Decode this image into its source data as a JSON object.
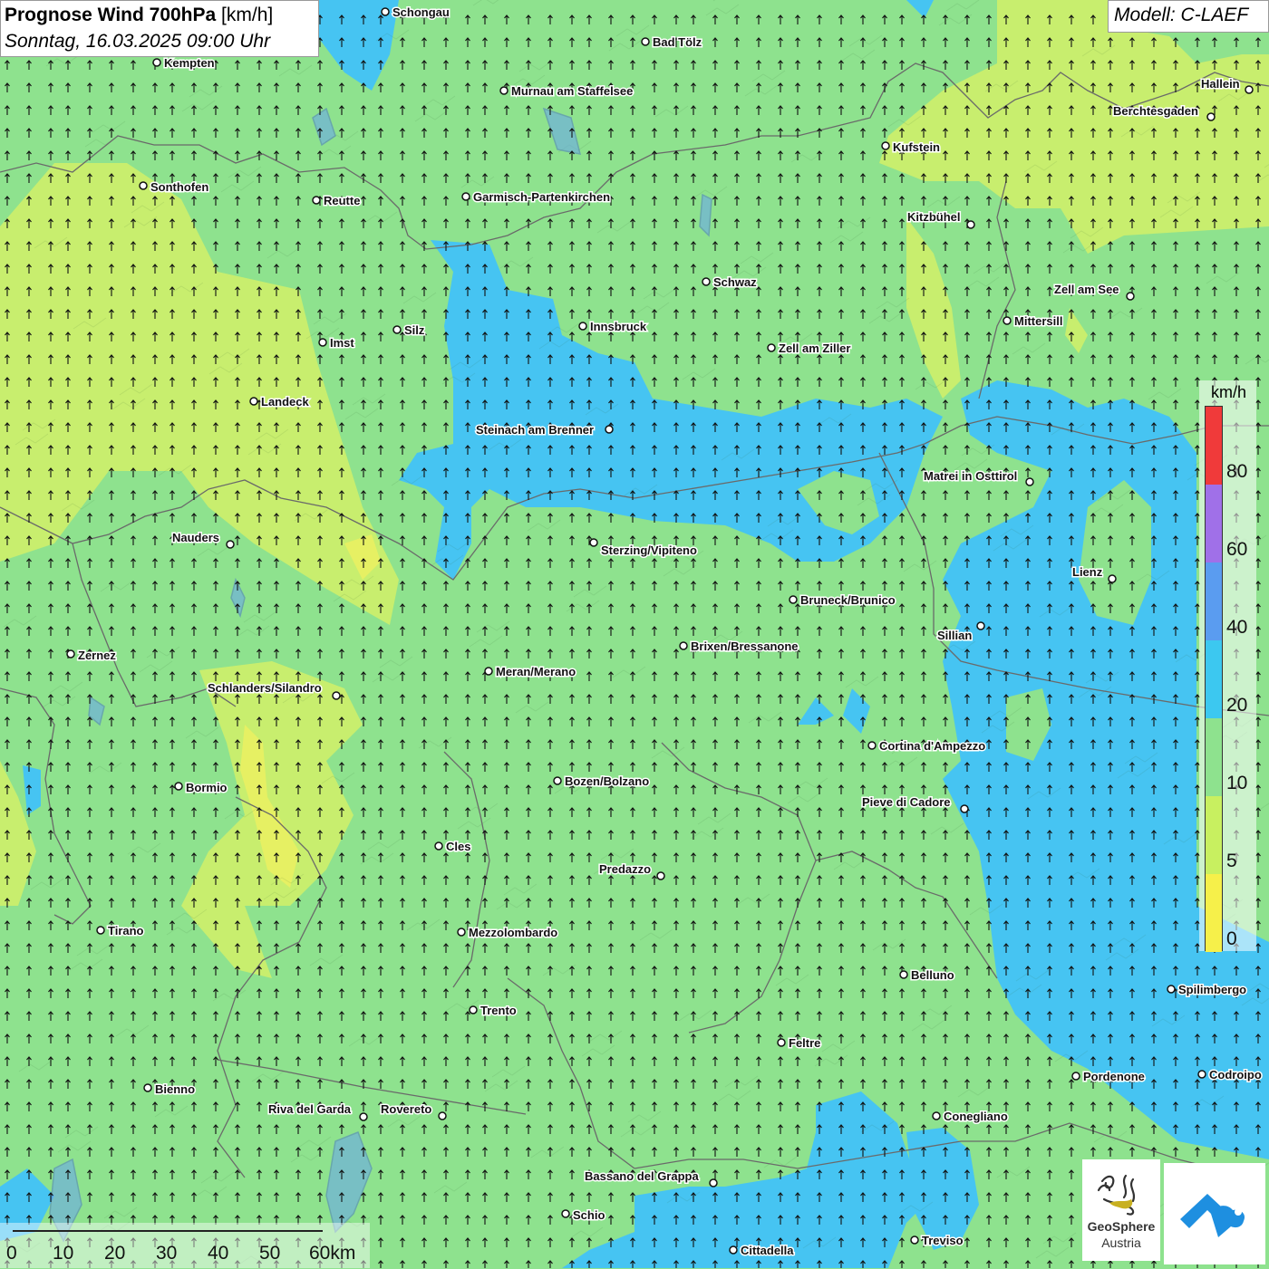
{
  "title": {
    "bold": "Prognose Wind 700hPa",
    "unit": "[km/h]",
    "subtitle": "Sonntag, 16.03.2025 09:00 Uhr"
  },
  "model": "Modell: C-LAEF",
  "legend": {
    "unit": "km/h",
    "labels": [
      "80",
      "60",
      "40",
      "20",
      "10",
      "5",
      "0"
    ],
    "colors": [
      "#f03a3a",
      "#a070e8",
      "#5a9cf0",
      "#3cc8f0",
      "#8ee28e",
      "#c8f060",
      "#f6f04a"
    ]
  },
  "scalebar": {
    "labels": [
      "0",
      "10",
      "20",
      "30",
      "40",
      "50",
      "60km"
    ]
  },
  "logos": {
    "geosphere_line1": "GeoSphere",
    "geosphere_line2": "Austria"
  },
  "map_colors": {
    "green": "#8ee28e",
    "yellow_green": "#c8ee6e",
    "blue": "#46c4f2",
    "border": "#666666"
  },
  "wind_direction": "north",
  "cities": [
    "Schongau",
    "Bad Tölz",
    "Kempten",
    "Murnau am Staffelsee",
    "Hallein",
    "Berchtesgaden",
    "Kufstein",
    "Sonthofen",
    "Reutte",
    "Garmisch-Partenkirchen",
    "Kitzbühel",
    "Schwaz",
    "Zell am See",
    "Innsbruck",
    "Silz",
    "Mittersill",
    "Imst",
    "Zell am Ziller",
    "Landeck",
    "Steinach am Brenner",
    "Matrei in Osttirol",
    "Nauders",
    "Sterzing/Vipiteno",
    "Lienz",
    "Bruneck/Brunico",
    "Sillian",
    "Zernez",
    "Brixen/Bressanone",
    "Meran/Merano",
    "Schlanders/Silandro",
    "Cortina d'Ampezzo",
    "Bozen/Bolzano",
    "Bormio",
    "Pieve di Cadore",
    "Cles",
    "Predazzo",
    "Tirano",
    "Mezzolombardo",
    "Belluno",
    "Spilimbergo",
    "Trento",
    "Feltre",
    "Pordenone",
    "Codroipo",
    "Bienno",
    "Riva del Garda",
    "Rovereto",
    "Conegliano",
    "Bassano del Grappa",
    "Schio",
    "Treviso",
    "Cittadella"
  ]
}
